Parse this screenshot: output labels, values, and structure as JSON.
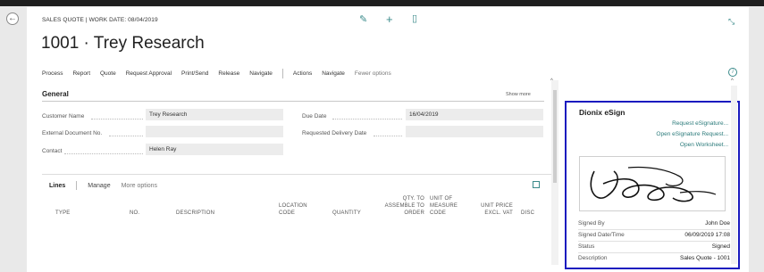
{
  "header": {
    "subtitle": "SALES QUOTE | WORK DATE: 08/04/2019",
    "title": "1001 · Trey Research"
  },
  "actions": [
    "Process",
    "Report",
    "Quote",
    "Request Approval",
    "Print/Send",
    "Release",
    "Navigate",
    "Actions",
    "Navigate",
    "Fewer options"
  ],
  "general": {
    "title": "General",
    "show_more": "Show more",
    "fields": {
      "customer_name": {
        "label": "Customer Name",
        "value": "Trey Research"
      },
      "external_doc": {
        "label": "External Document No.",
        "value": ""
      },
      "contact": {
        "label": "Contact",
        "value": "Helen Ray"
      },
      "due_date": {
        "label": "Due Date",
        "value": "16/04/2019"
      },
      "requested_delivery": {
        "label": "Requested Delivery Date",
        "value": ""
      }
    }
  },
  "lines": {
    "tabs": [
      "Lines",
      "Manage",
      "More options"
    ],
    "columns": {
      "type": "TYPE",
      "no": "NO.",
      "description": "DESCRIPTION",
      "location_1": "LOCATION",
      "location_2": "CODE",
      "quantity": "QUANTITY",
      "qty_1": "QTY. TO",
      "qty_2": "ASSEMBLE TO",
      "qty_3": "ORDER",
      "uom_1": "UNIT OF",
      "uom_2": "MEASURE",
      "uom_3": "CODE",
      "price_1": "UNIT PRICE",
      "price_2": "EXCL. VAT",
      "disc": "DISC"
    }
  },
  "esign": {
    "title": "Dionix eSign",
    "links": [
      "Request eSignature",
      "Open eSignature Request",
      "Open Worksheet"
    ],
    "ellipsis": "...",
    "details": [
      {
        "key": "Signed By",
        "value": "John Doe"
      },
      {
        "key": "Signed Date/Time",
        "value": "06/09/2019 17:08"
      },
      {
        "key": "Status",
        "value": "Signed"
      },
      {
        "key": "Description",
        "value": "Sales Quote - 1001"
      }
    ]
  },
  "icons": {
    "back": "arrow-left-icon",
    "edit": "pencil-icon",
    "add": "plus-icon",
    "delete": "trash-icon",
    "collapse": "collapse-icon",
    "info": "info-icon",
    "expand": "expand-icon"
  },
  "colors": {
    "accent": "#3a8a8a",
    "esign_border": "#1a1abf",
    "topbar": "#1e1e1e"
  }
}
